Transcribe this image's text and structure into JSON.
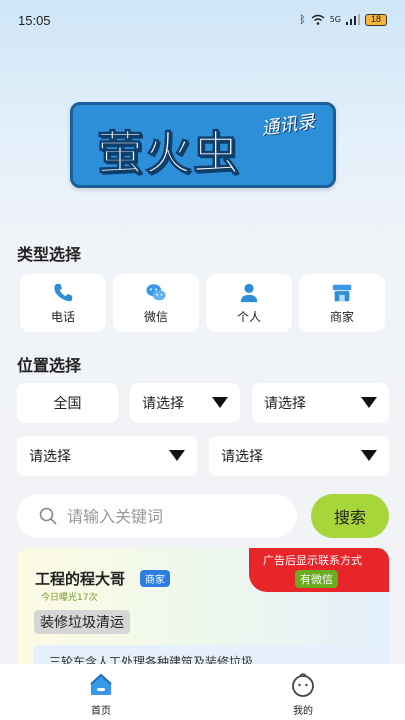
{
  "status_bar": {
    "time": "15:05",
    "network": "5G",
    "battery": "18"
  },
  "logo": {
    "main": "萤火虫",
    "sub": "通讯录"
  },
  "type_section": {
    "title": "类型选择",
    "items": [
      {
        "label": "电话",
        "icon": "phone-icon"
      },
      {
        "label": "微信",
        "icon": "wechat-icon"
      },
      {
        "label": "个人",
        "icon": "person-icon"
      },
      {
        "label": "商家",
        "icon": "store-icon"
      }
    ]
  },
  "location_section": {
    "title": "位置选择",
    "all_label": "全国",
    "selects": [
      "请选择",
      "请选择",
      "请选择",
      "请选择"
    ]
  },
  "search": {
    "placeholder": "请输入关键词",
    "button_label": "搜索"
  },
  "listing": {
    "title": "工程的程大哥",
    "badge": "商家",
    "views": "今日曝光17次",
    "tag": "装修垃圾清运",
    "description": "三轮车含人工处理各种建筑及装修垃圾",
    "ad_text": "广告后显示联系方式",
    "ad_wechat": "有微信"
  },
  "tab_bar": {
    "items": [
      {
        "label": "首页",
        "icon": "home-icon",
        "active": true
      },
      {
        "label": "我的",
        "icon": "profile-icon",
        "active": false
      }
    ]
  },
  "colors": {
    "accent_blue": "#2d8fd8",
    "search_button": "#a6d63a",
    "ad_red": "#e8262a"
  }
}
